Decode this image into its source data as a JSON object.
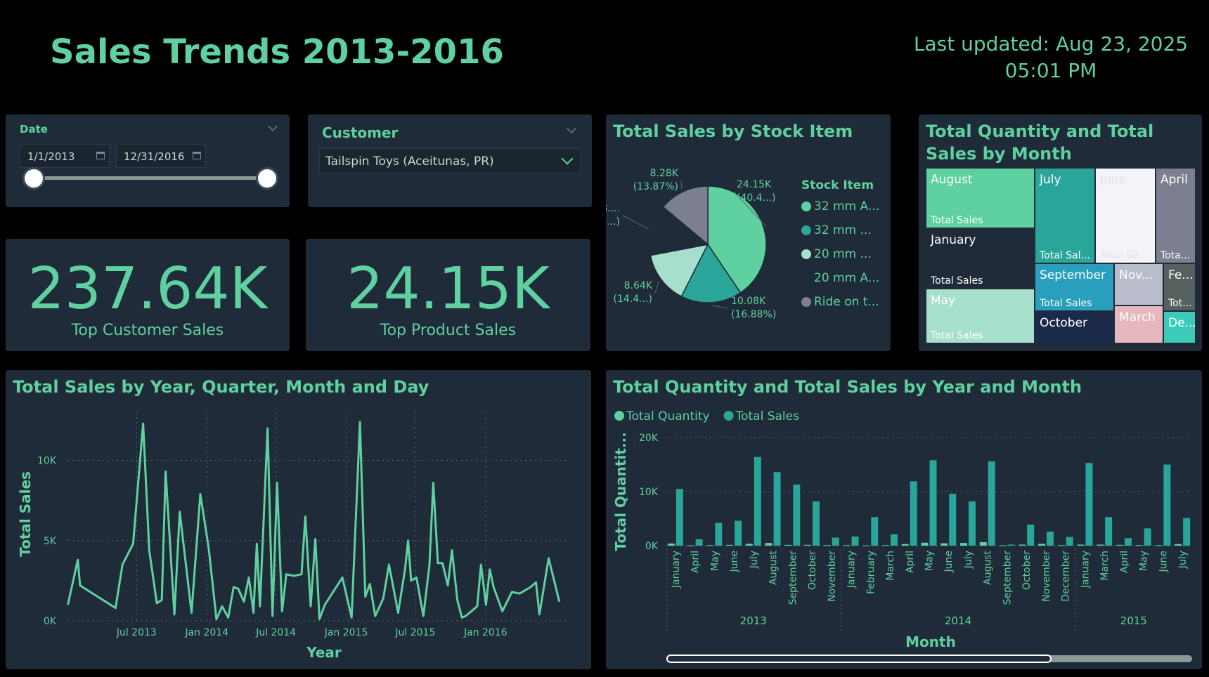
{
  "page": {
    "title": "Sales Trends 2013-2016",
    "updated_line1": "Last updated: Aug 23, 2025",
    "updated_line2": "05:01 PM"
  },
  "date_slicer": {
    "label": "Date",
    "start": "1/1/2013",
    "end": "12/31/2016"
  },
  "customer_slicer": {
    "label": "Customer",
    "selected": "Tailspin Toys (Aceitunas, PR)"
  },
  "kpis": [
    {
      "value": "237.64K",
      "label": "Top Customer Sales"
    },
    {
      "value": "24.15K",
      "label": "Top Product Sales"
    }
  ],
  "colors": {
    "accent": "#5fd0a0",
    "teal": "#2aa59a",
    "card": "#1f2b38",
    "background": "#000000"
  },
  "chart_data": [
    {
      "type": "pie",
      "title": "Total Sales by Stock Item",
      "legend_title": "Stock Item",
      "legend": [
        {
          "label": "32 mm A...",
          "color": "#5fd0a0"
        },
        {
          "label": "32 mm ...",
          "color": "#2aa59a"
        },
        {
          "label": "20 mm ...",
          "color": "#a6e0cc"
        },
        {
          "label": "20 mm A...",
          "color": "#1f2b38"
        },
        {
          "label": "Ride on t...",
          "color": "#7b7f8f"
        }
      ],
      "slices": [
        {
          "value": 24150,
          "percent": 40.4,
          "label1": "24.15K",
          "label2": "(40.4...)",
          "color": "#5fd0a0"
        },
        {
          "value": 10080,
          "percent": 16.88,
          "label1": "10.08K",
          "label2": "(16.88%)",
          "color": "#2aa59a"
        },
        {
          "value": 8640,
          "percent": 14.45,
          "label1": "8.64K",
          "label2": "(14.4...)",
          "color": "#a6e0cc"
        },
        {
          "value": 8400,
          "percent": 14.4,
          "label1": "8....",
          "label2": "(...)",
          "color": "#1f2b38"
        },
        {
          "value": 8280,
          "percent": 13.87,
          "label1": "8.28K",
          "label2": "(13.87%)",
          "color": "#7b7f8f"
        }
      ]
    },
    {
      "type": "treemap",
      "title": "Total Quantity and Total Sales by Month",
      "cells": [
        {
          "name": "August",
          "sub": "Total Sales",
          "color": "#5fd0a0",
          "text": "#ffffff"
        },
        {
          "name": "July",
          "sub": "Total Sal...",
          "color": "#2aa59a",
          "text": "#ffffff"
        },
        {
          "name": "June",
          "sub": "Total Sa...",
          "color": "#f4f4f8",
          "text": "#dfe2ea"
        },
        {
          "name": "April",
          "sub": "Tota...",
          "color": "#7b7f8f",
          "text": "#ffffff"
        },
        {
          "name": "January",
          "sub": "Total Sales",
          "color": "#1f2b38",
          "text": "#ffffff"
        },
        {
          "name": "September",
          "sub": "Total Sales",
          "color": "#2a9fbd",
          "text": "#ffffff"
        },
        {
          "name": "Nov...",
          "sub": "",
          "color": "#b8bccb",
          "text": "#ffffff"
        },
        {
          "name": "Fe...",
          "sub": "Tot...",
          "color": "#56605f",
          "text": "#ffffff"
        },
        {
          "name": "May",
          "sub": "Total Sales",
          "color": "#a6e0cc",
          "text": "#ffffff"
        },
        {
          "name": "October",
          "sub": "",
          "color": "#1c2a4a",
          "text": "#ffffff"
        },
        {
          "name": "March",
          "sub": "",
          "color": "#e4b8be",
          "text": "#ffffff"
        },
        {
          "name": "De...",
          "sub": "",
          "color": "#3ccbb8",
          "text": "#ffffff"
        }
      ]
    },
    {
      "type": "line",
      "title": "Total Sales by Year, Quarter, Month and Day",
      "xlabel": "Year",
      "ylabel": "Total Sales",
      "ylim": [
        0,
        13000
      ],
      "yticks": [
        0,
        5000,
        10000
      ],
      "ytick_labels": [
        "0K",
        "5K",
        "10K"
      ],
      "xticks": [
        "Jul 2013",
        "Jan 2014",
        "Jul 2014",
        "Jan 2015",
        "Jul 2015",
        "Jan 2016"
      ],
      "x_range": [
        "2013-01-01",
        "2016-07-31"
      ],
      "x_tick_dates": [
        "2013-07-01",
        "2014-01-01",
        "2014-07-01",
        "2015-01-01",
        "2015-07-01",
        "2016-01-01"
      ],
      "points": [
        [
          "2013-01-02",
          1000
        ],
        [
          "2013-01-28",
          3800
        ],
        [
          "2013-02-03",
          2200
        ],
        [
          "2013-05-07",
          800
        ],
        [
          "2013-05-25",
          3500
        ],
        [
          "2013-06-22",
          4800
        ],
        [
          "2013-07-18",
          12300
        ],
        [
          "2013-08-03",
          4400
        ],
        [
          "2013-08-23",
          1100
        ],
        [
          "2013-09-05",
          1300
        ],
        [
          "2013-09-15",
          9300
        ],
        [
          "2013-10-08",
          400
        ],
        [
          "2013-10-22",
          6800
        ],
        [
          "2013-11-22",
          500
        ],
        [
          "2013-12-15",
          7900
        ],
        [
          "2014-01-06",
          4500
        ],
        [
          "2014-01-26",
          100
        ],
        [
          "2014-02-10",
          900
        ],
        [
          "2014-02-26",
          200
        ],
        [
          "2014-03-12",
          2100
        ],
        [
          "2014-03-24",
          2000
        ],
        [
          "2014-04-08",
          1200
        ],
        [
          "2014-04-21",
          2700
        ],
        [
          "2014-05-03",
          500
        ],
        [
          "2014-05-12",
          4800
        ],
        [
          "2014-05-20",
          900
        ],
        [
          "2014-06-09",
          12000
        ],
        [
          "2014-06-22",
          300
        ],
        [
          "2014-07-04",
          8600
        ],
        [
          "2014-07-17",
          600
        ],
        [
          "2014-07-28",
          2900
        ],
        [
          "2014-08-17",
          2800
        ],
        [
          "2014-09-06",
          2900
        ],
        [
          "2014-09-16",
          6500
        ],
        [
          "2014-09-30",
          900
        ],
        [
          "2014-10-12",
          5100
        ],
        [
          "2014-10-23",
          100
        ],
        [
          "2014-11-06",
          1000
        ],
        [
          "2014-12-22",
          2700
        ],
        [
          "2015-01-15",
          200
        ],
        [
          "2015-02-06",
          12400
        ],
        [
          "2015-02-20",
          1500
        ],
        [
          "2015-03-04",
          2300
        ],
        [
          "2015-03-18",
          300
        ],
        [
          "2015-04-08",
          1400
        ],
        [
          "2015-04-23",
          3500
        ],
        [
          "2015-05-17",
          500
        ],
        [
          "2015-06-04",
          3200
        ],
        [
          "2015-06-12",
          5000
        ],
        [
          "2015-06-20",
          2500
        ],
        [
          "2015-07-04",
          2700
        ],
        [
          "2015-07-22",
          300
        ],
        [
          "2015-08-07",
          3500
        ],
        [
          "2015-08-17",
          8600
        ],
        [
          "2015-08-29",
          3600
        ],
        [
          "2015-09-10",
          3600
        ],
        [
          "2015-09-24",
          2200
        ],
        [
          "2015-10-05",
          4400
        ],
        [
          "2015-10-19",
          1300
        ],
        [
          "2015-10-31",
          200
        ],
        [
          "2015-11-10",
          300
        ],
        [
          "2015-12-10",
          900
        ],
        [
          "2015-12-20",
          3500
        ],
        [
          "2016-01-02",
          1000
        ],
        [
          "2016-01-12",
          3200
        ],
        [
          "2016-01-22",
          2100
        ],
        [
          "2016-02-14",
          600
        ],
        [
          "2016-03-10",
          1800
        ],
        [
          "2016-03-30",
          1700
        ],
        [
          "2016-04-28",
          2100
        ],
        [
          "2016-05-12",
          2400
        ],
        [
          "2016-05-21",
          400
        ],
        [
          "2016-06-14",
          3900
        ],
        [
          "2016-07-12",
          1200
        ]
      ]
    },
    {
      "type": "bar",
      "title": "Total Quantity and Total Sales by Year and Month",
      "xlabel": "Month",
      "ylabel": "Total Quantit...",
      "ylim": [
        0,
        20000
      ],
      "yticks": [
        0,
        10000,
        20000
      ],
      "ytick_labels": [
        "0K",
        "10K",
        "20K"
      ],
      "legend": [
        {
          "name": "Total Quantity",
          "color": "#5fd0a0"
        },
        {
          "name": "Total Sales",
          "color": "#2aa59a"
        }
      ],
      "groups": [
        {
          "year": "2013",
          "months": [
            "January",
            "April",
            "May",
            "June",
            "July",
            "August",
            "September",
            "October",
            "November"
          ]
        },
        {
          "year": "2014",
          "months": [
            "January",
            "February",
            "March",
            "April",
            "May",
            "June",
            "July",
            "August",
            "September",
            "October",
            "November",
            "December"
          ]
        },
        {
          "year": "2015",
          "months": [
            "January",
            "March",
            "April",
            "May",
            "June",
            "July"
          ]
        }
      ],
      "series": [
        {
          "name": "Total Quantity",
          "values": [
            400,
            50,
            100,
            150,
            350,
            500,
            150,
            150,
            100,
            100,
            50,
            100,
            300,
            550,
            450,
            500,
            650,
            50,
            200,
            350,
            100,
            200,
            200,
            150,
            100,
            100,
            300,
            350
          ]
        },
        {
          "name": "Total Sales",
          "values": [
            10500,
            1200,
            4200,
            4600,
            16400,
            13600,
            11300,
            8200,
            1500,
            1700,
            5300,
            2100,
            11900,
            15800,
            9600,
            8200,
            15600,
            200,
            3900,
            2600,
            1600,
            15300,
            5300,
            1400,
            3200,
            15000,
            5100,
            100
          ]
        }
      ]
    }
  ]
}
